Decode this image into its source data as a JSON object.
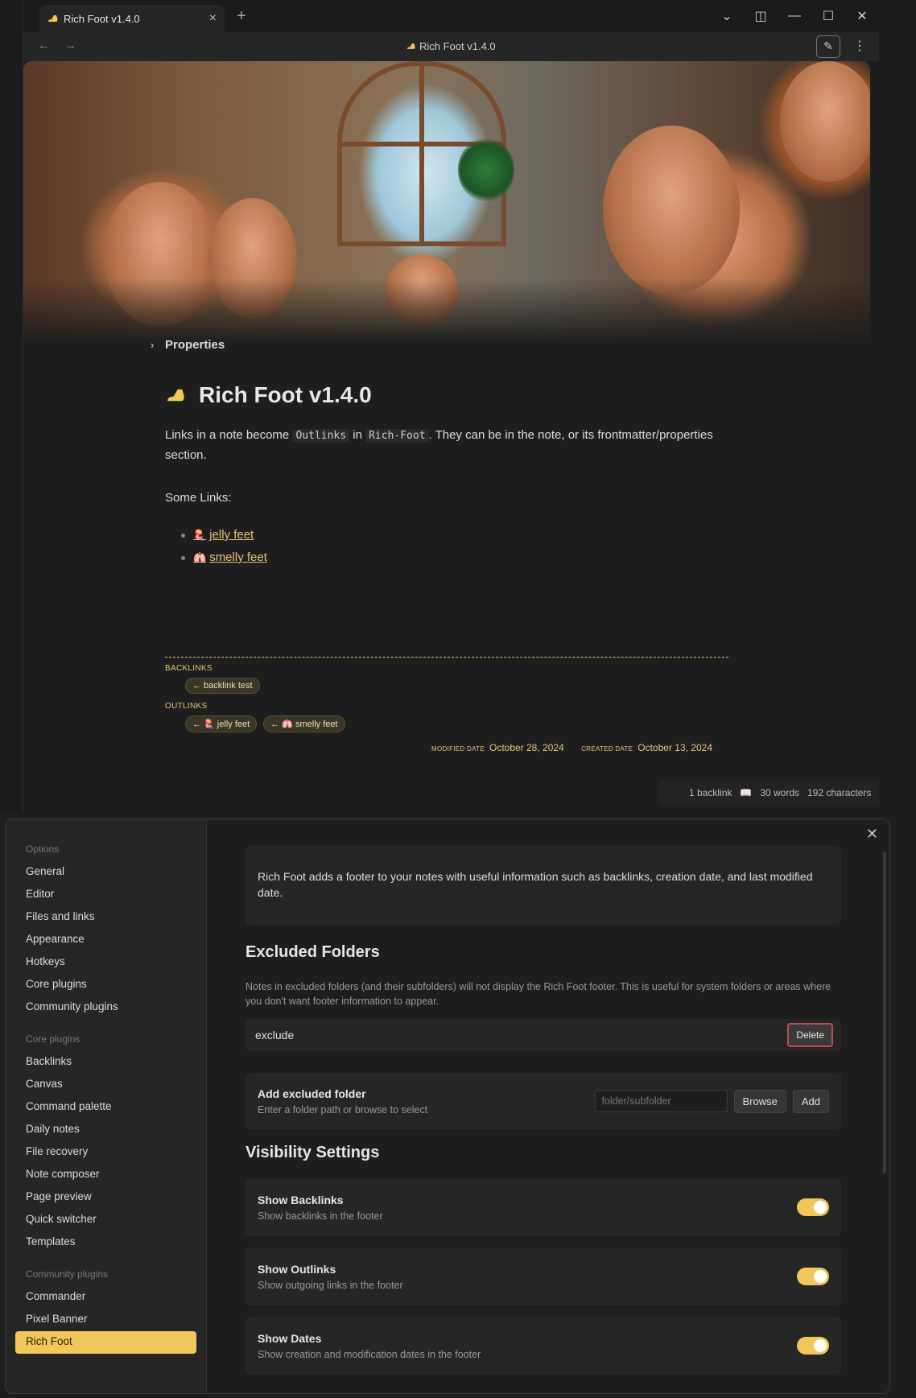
{
  "window": {
    "tab_title": "Rich Foot v1.4.0",
    "new_tab": "+",
    "nav_title": "Rich Foot v1.4.0"
  },
  "note": {
    "properties_label": "Properties",
    "title": "Rich Foot v1.4.0",
    "intro_pre": "Links in a note become ",
    "intro_code1": "Outlinks",
    "intro_mid": " in ",
    "intro_code2": "Rich-Foot",
    "intro_post": ". They can be in the note, or its frontmatter/properties section.",
    "some_links": "Some Links:",
    "links": [
      {
        "emoji": "🪼",
        "text": "jelly feet"
      },
      {
        "emoji": "🫁",
        "text": "smelly feet"
      }
    ]
  },
  "rich_foot": {
    "backlinks_label": "BACKLINKS",
    "backlinks": [
      "← backlink test"
    ],
    "outlinks_label": "OUTLINKS",
    "outlinks": [
      "← 🪼 jelly feet",
      "← 🫁 smelly feet"
    ],
    "modified_label": "MODIFIED DATE",
    "modified_value": "October 28, 2024",
    "created_label": "CREATED DATE",
    "created_value": "October 13, 2024"
  },
  "status_bar": {
    "backlinks": "1 backlink",
    "words": "30 words",
    "characters": "192 characters"
  },
  "settings": {
    "sidebar": {
      "groups": [
        {
          "label": "Options",
          "items": [
            "General",
            "Editor",
            "Files and links",
            "Appearance",
            "Hotkeys",
            "Core plugins",
            "Community plugins"
          ]
        },
        {
          "label": "Core plugins",
          "items": [
            "Backlinks",
            "Canvas",
            "Command palette",
            "Daily notes",
            "File recovery",
            "Note composer",
            "Page preview",
            "Quick switcher",
            "Templates"
          ]
        },
        {
          "label": "Community plugins",
          "items": [
            "Commander",
            "Pixel Banner",
            "Rich Foot"
          ]
        }
      ],
      "active": "Rich Foot"
    },
    "description": "Rich Foot adds a footer to your notes with useful information such as backlinks, creation date, and last modified date.",
    "excluded_heading": "Excluded Folders",
    "excluded_desc": "Notes in excluded folders (and their subfolders) will not display the Rich Foot footer. This is useful for system folders or areas where you don't want footer information to appear.",
    "excluded_folder": "exclude",
    "delete_label": "Delete",
    "add_folder_name": "Add excluded folder",
    "add_folder_desc": "Enter a folder path or browse to select",
    "folder_placeholder": "folder/subfolder",
    "browse_label": "Browse",
    "add_label": "Add",
    "visibility_heading": "Visibility Settings",
    "toggles": [
      {
        "name": "Show Backlinks",
        "desc": "Show backlinks in the footer",
        "on": true
      },
      {
        "name": "Show Outlinks",
        "desc": "Show outgoing links in the footer",
        "on": true
      },
      {
        "name": "Show Dates",
        "desc": "Show creation and modification dates in the footer",
        "on": true
      }
    ]
  },
  "colors": {
    "accent": "#f1c75b",
    "link": "#e8c27a",
    "background": "#1e1e1e",
    "panel": "#262626"
  }
}
